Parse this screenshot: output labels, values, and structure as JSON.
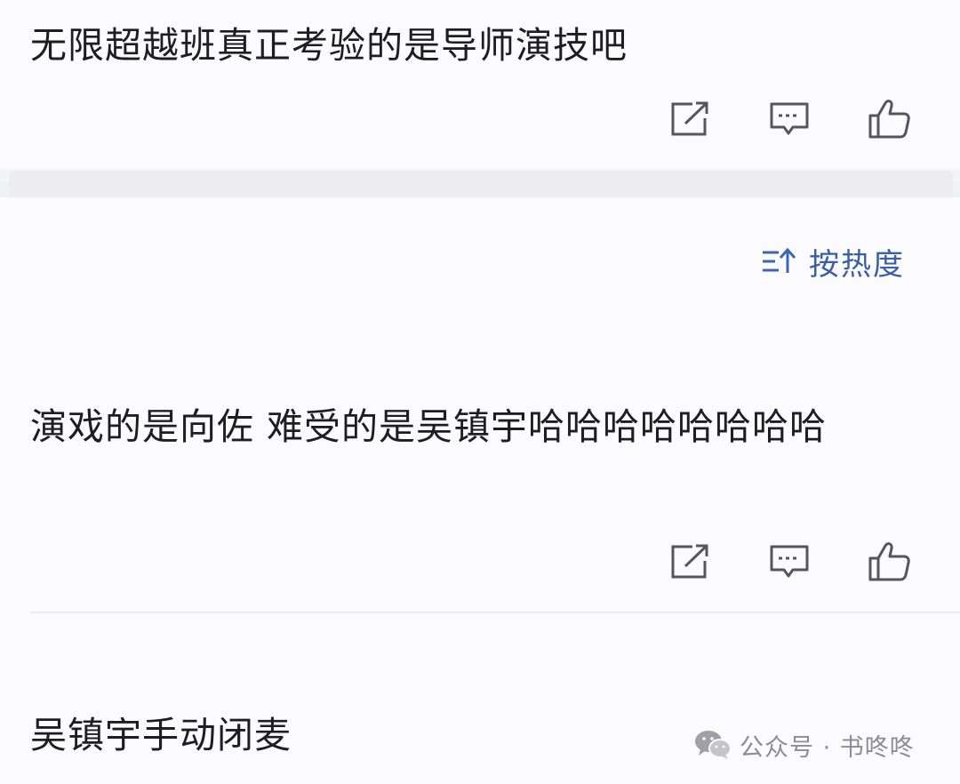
{
  "comments": [
    {
      "text": "无限超越班真正考验的是导师演技吧",
      "actions": [
        "share-icon",
        "reply-icon",
        "like-icon"
      ]
    },
    {
      "text": "演戏的是向佐 难受的是吴镇宇哈哈哈哈哈哈哈哈",
      "actions": [
        "share-icon",
        "reply-icon",
        "like-icon"
      ]
    },
    {
      "text": "吴镇宇手动闭麦"
    }
  ],
  "sort": {
    "label": "按热度",
    "icon": "sort-icon"
  },
  "watermark": {
    "text": "公众号 · 书咚咚",
    "icon": "wechat-icon"
  },
  "colors": {
    "accent": "#3a5fa6",
    "icon_stroke": "#55555c",
    "background": "#fbfbfe"
  }
}
